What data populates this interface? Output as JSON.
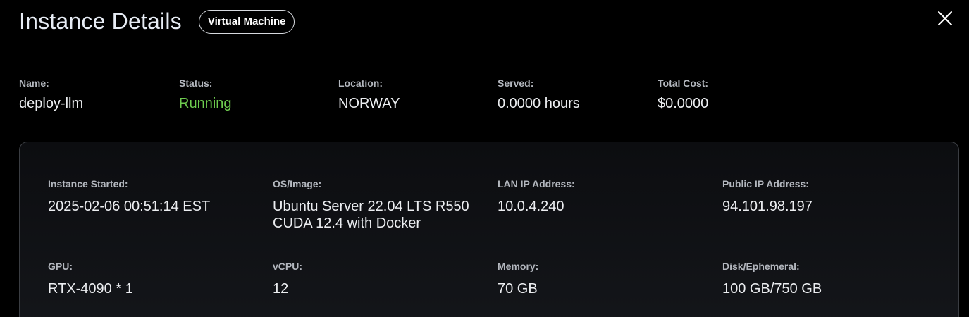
{
  "header": {
    "title": "Instance Details",
    "badge": "Virtual Machine"
  },
  "summary": {
    "name_label": "Name:",
    "name_value": "deploy-llm",
    "status_label": "Status:",
    "status_value": "Running",
    "location_label": "Location:",
    "location_value": "NORWAY",
    "served_label": "Served:",
    "served_value": "0.0000 hours",
    "cost_label": "Total Cost:",
    "cost_value": "$0.0000"
  },
  "details": {
    "started_label": "Instance Started:",
    "started_value": "2025-02-06 00:51:14 EST",
    "os_label": "OS/Image:",
    "os_value": "Ubuntu Server 22.04 LTS R550 CUDA 12.4 with Docker",
    "lan_label": "LAN IP Address:",
    "lan_value": "10.0.4.240",
    "public_label": "Public IP Address:",
    "public_value": "94.101.98.197",
    "gpu_label": "GPU:",
    "gpu_value": "RTX-4090 * 1",
    "vcpu_label": "vCPU:",
    "vcpu_value": "12",
    "memory_label": "Memory:",
    "memory_value": "70 GB",
    "disk_label": "Disk/Ephemeral:",
    "disk_value": "100 GB/750 GB"
  },
  "colors": {
    "background": "#000000",
    "status_running": "#6ecb4f",
    "label": "#b3b7be"
  },
  "icons": {
    "close": "close-icon"
  }
}
